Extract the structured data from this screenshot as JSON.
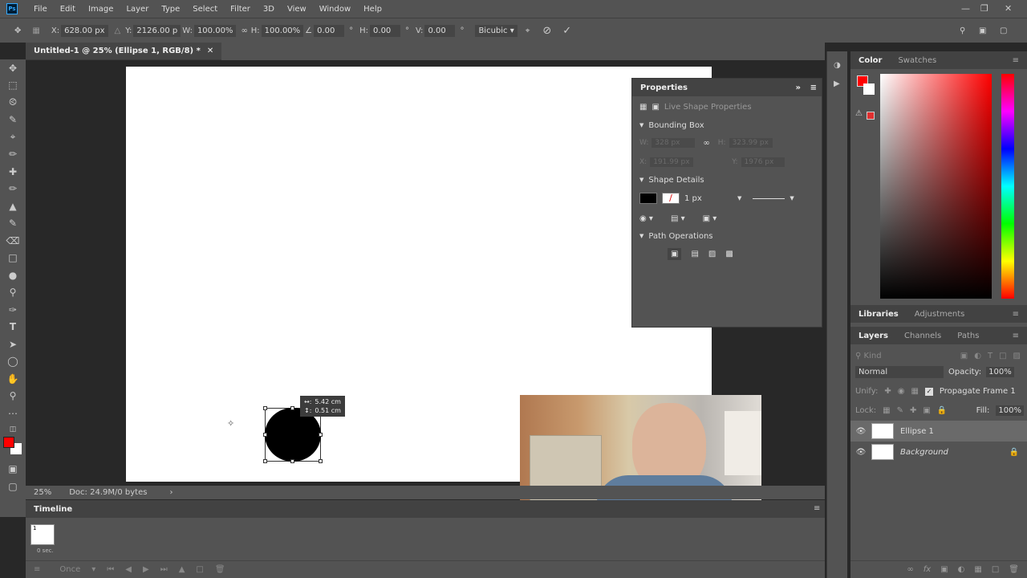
{
  "menu": {
    "logo": "Ps",
    "items": [
      "File",
      "Edit",
      "Image",
      "Layer",
      "Type",
      "Select",
      "Filter",
      "3D",
      "View",
      "Window",
      "Help"
    ]
  },
  "options": {
    "x_label": "X:",
    "x_value": "628.00 px",
    "y_label": "Y:",
    "y_value": "2126.00 p",
    "w_label": "W:",
    "w_value": "100.00%",
    "h_label": "H:",
    "h_value": "100.00%",
    "angle_value": "0.00",
    "angle_unit": "°",
    "hskew_label": "H:",
    "hskew_value": "0.00",
    "hskew_unit": "°",
    "vskew_label": "V:",
    "vskew_value": "0.00",
    "vskew_unit": "°",
    "interp": "Bicubic"
  },
  "document": {
    "tab_title": "Untitled-1 @ 25% (Ellipse 1, RGB/8) *"
  },
  "status": {
    "zoom": "25%",
    "doc_info": "Doc: 24.9M/0 bytes"
  },
  "timeline": {
    "title": "Timeline",
    "frame_num": "1",
    "frame_time": "0 sec.",
    "loop": "Once"
  },
  "transform_tip": {
    "line1": "5.42 cm",
    "line2": "0.51 cm"
  },
  "properties": {
    "title": "Properties",
    "subtitle": "Live Shape Properties",
    "bbox_title": "Bounding Box",
    "w_label": "W:",
    "w_val": "328 px",
    "h_label": "H:",
    "h_val": "323.99 px",
    "x_label": "X:",
    "x_val": "191.99 px",
    "y_label": "Y:",
    "y_val": "1976 px",
    "shape_title": "Shape Details",
    "stroke_width": "1 px",
    "pathops_title": "Path Operations"
  },
  "color_panel": {
    "tab_color": "Color",
    "tab_swatches": "Swatches",
    "fg_color": "#ff0000"
  },
  "lib_tabs": {
    "libraries": "Libraries",
    "adjustments": "Adjustments"
  },
  "layers": {
    "tab_layers": "Layers",
    "tab_channels": "Channels",
    "tab_paths": "Paths",
    "kind": "Kind",
    "blend": "Normal",
    "opacity_label": "Opacity:",
    "opacity": "100%",
    "unify_label": "Unify:",
    "propagate": "Propagate Frame 1",
    "lock_label": "Lock:",
    "fill_label": "Fill:",
    "fill": "100%",
    "items": [
      {
        "name": "Ellipse 1"
      },
      {
        "name": "Background"
      }
    ]
  }
}
